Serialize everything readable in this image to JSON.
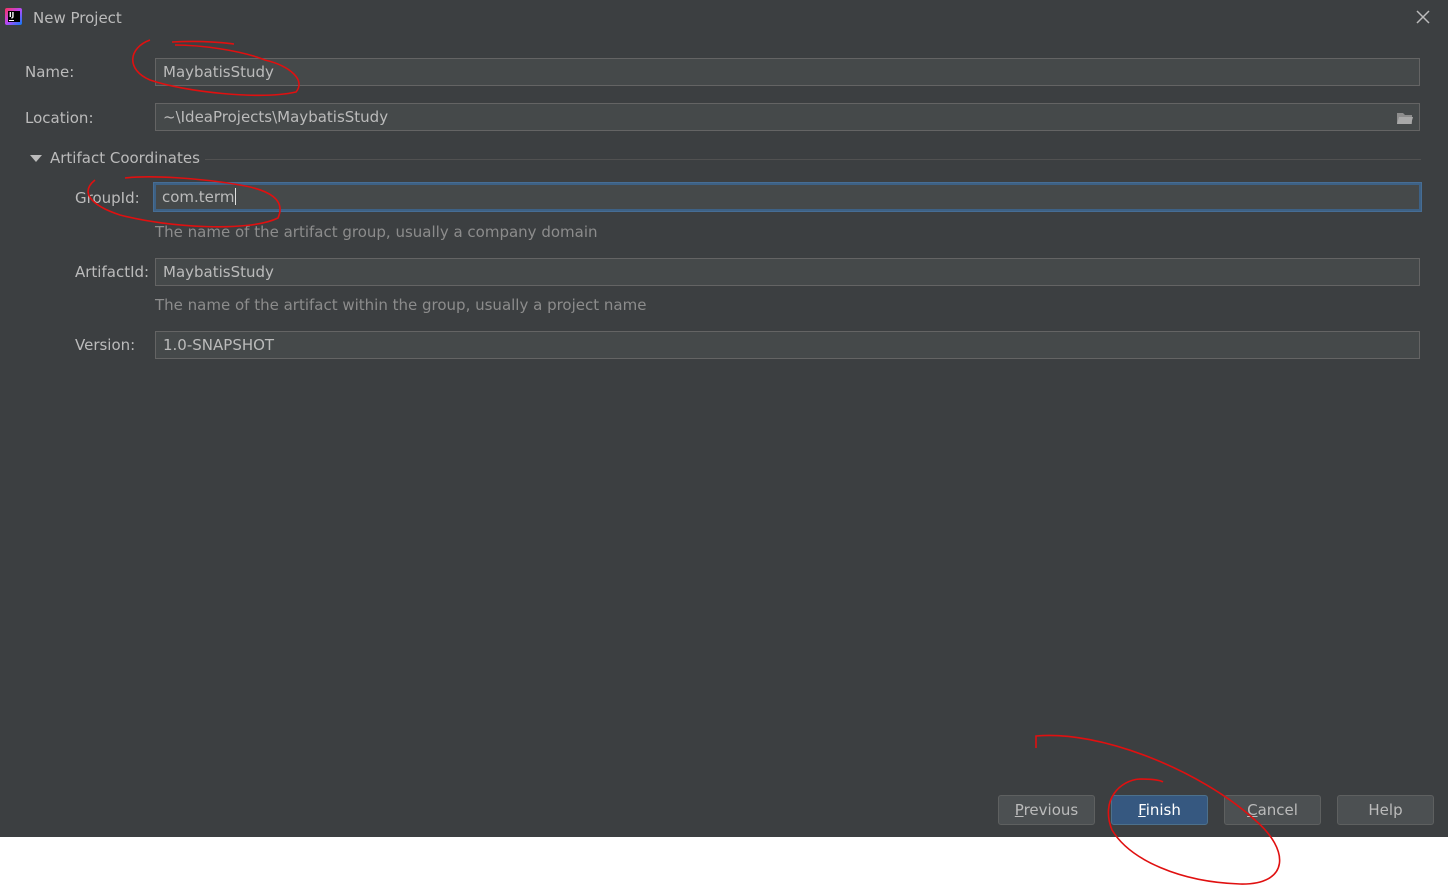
{
  "window": {
    "title": "New Project"
  },
  "form": {
    "name": {
      "label": "Name:",
      "value": "MaybatisStudy"
    },
    "location": {
      "label": "Location:",
      "value": "~\\IdeaProjects\\MaybatisStudy"
    },
    "section": {
      "label": "Artifact Coordinates",
      "expanded": true
    },
    "group_id": {
      "label": "GroupId:",
      "value": "com.term",
      "hint": "The name of the artifact group, usually a company domain"
    },
    "artifact_id": {
      "label": "ArtifactId:",
      "value": "MaybatisStudy",
      "hint": "The name of the artifact within the group, usually a project name"
    },
    "version": {
      "label": "Version:",
      "value": "1.0-SNAPSHOT"
    }
  },
  "buttons": {
    "previous": {
      "mnemonic": "P",
      "rest": "revious"
    },
    "finish": {
      "mnemonic": "F",
      "rest": "inish"
    },
    "cancel": {
      "mnemonic": "C",
      "rest": "ancel"
    },
    "help": {
      "label": "Help"
    }
  },
  "icons": {
    "app": "intellij-idea-icon",
    "close": "close-icon",
    "browse": "folder-icon",
    "section_toggle": "triangle-down-icon"
  },
  "colors": {
    "dialog_bg": "#3c3f41",
    "text": "#bbbbbb",
    "hint": "#8c8c8c",
    "field_bg": "#45494a",
    "focus": "#3d6185",
    "primary_button": "#365880",
    "annotation": "#e01010"
  }
}
